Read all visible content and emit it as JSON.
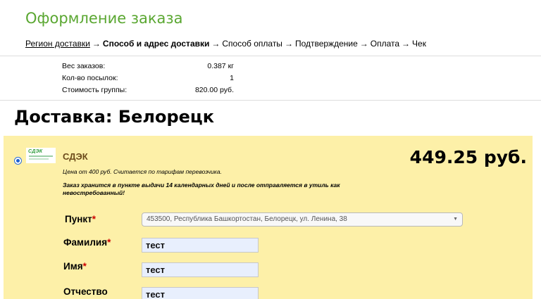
{
  "page": {
    "title": "Оформление заказа"
  },
  "breadcrumb": {
    "steps": [
      {
        "label": "Регион доставки"
      },
      {
        "label": "Способ и адрес доставки"
      },
      {
        "label": "Способ оплаты"
      },
      {
        "label": "Подтверждение"
      },
      {
        "label": "Оплата"
      },
      {
        "label": "Чек"
      }
    ],
    "arrow": "→"
  },
  "summary": {
    "rows": [
      {
        "label": "Вес заказов:",
        "value": "0.387 кг"
      },
      {
        "label": "Кол-во посылок:",
        "value": "1"
      },
      {
        "label": "Стоимость группы:",
        "value": "820.00 руб."
      }
    ]
  },
  "delivery": {
    "heading": "Доставка: Белорецк"
  },
  "carrier": {
    "logo_text": "СДЭК",
    "name": "СДЭК",
    "price": "449.25 руб.",
    "note_price": "Цена от 400 руб. Считается по тарифам перевозчика.",
    "note_storage": "Заказ хранится в пункте выдачи 14 календарных дней и после отправляется в утиль как невостребованный!",
    "colors": {
      "panel": "#fdf0a8",
      "accent": "#5aa731"
    }
  },
  "form": {
    "required_mark": "*",
    "point": {
      "label": "Пункт",
      "value": "453500, Республика Башкортостан, Белорецк, ул. Ленина, 38"
    },
    "last_name": {
      "label": "Фамилия",
      "value": "тест"
    },
    "first_name": {
      "label": "Имя",
      "value": "тест"
    },
    "patronymic": {
      "label": "Отчество",
      "value": "тест"
    }
  }
}
